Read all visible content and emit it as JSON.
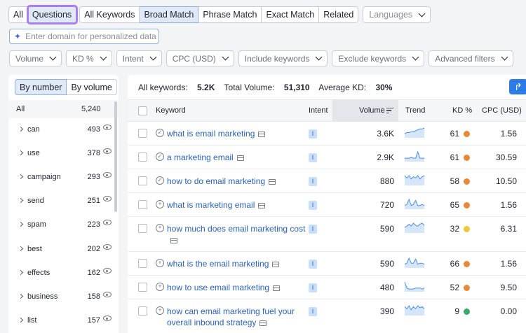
{
  "tabs": {
    "all": "All",
    "questions": "Questions",
    "all_keywords": "All Keywords",
    "broad_match": "Broad Match",
    "phrase_match": "Phrase Match",
    "exact_match": "Exact Match",
    "related": "Related",
    "languages": "Languages"
  },
  "domain_input": {
    "placeholder": "Enter domain for personalized data"
  },
  "filters": {
    "volume": "Volume",
    "kd": "KD %",
    "intent": "Intent",
    "cpc": "CPC (USD)",
    "include": "Include keywords",
    "exclude": "Exclude keywords",
    "advanced": "Advanced filters"
  },
  "left_panel": {
    "by_number": "By number",
    "by_volume": "By volume",
    "all_label": "All",
    "all_count": "5,240",
    "items": [
      {
        "name": "can",
        "count": "493"
      },
      {
        "name": "use",
        "count": "378"
      },
      {
        "name": "campaign",
        "count": "293"
      },
      {
        "name": "send",
        "count": "251"
      },
      {
        "name": "spam",
        "count": "223"
      },
      {
        "name": "best",
        "count": "202"
      },
      {
        "name": "effects",
        "count": "162"
      },
      {
        "name": "business",
        "count": "158"
      },
      {
        "name": "list",
        "count": "157"
      }
    ]
  },
  "summary": {
    "all_keywords_label": "All keywords:",
    "all_keywords_value": "5.2K",
    "total_volume_label": "Total Volume:",
    "total_volume_value": "51,310",
    "avg_kd_label": "Average KD:",
    "avg_kd_value": "30%"
  },
  "table": {
    "headers": {
      "keyword": "Keyword",
      "intent": "Intent",
      "volume": "Volume",
      "trend": "Trend",
      "kd": "KD %",
      "cpc": "CPC (USD)"
    },
    "rows": [
      {
        "keyword": "what is email marketing",
        "status": "check",
        "intent": "I",
        "volume": "3.6K",
        "kd": "61",
        "kd_color": "#e8893a",
        "cpc": "1.56",
        "trend": [
          4,
          5,
          5,
          6,
          6,
          7,
          8,
          9,
          9,
          10
        ]
      },
      {
        "keyword": "a marketing email",
        "status": "check",
        "intent": "I",
        "volume": "2.9K",
        "kd": "61",
        "kd_color": "#e8893a",
        "cpc": "30.59",
        "trend": [
          3,
          3,
          3,
          4,
          3,
          3,
          10,
          3,
          3,
          3
        ]
      },
      {
        "keyword": "how to do email marketing",
        "status": "check",
        "intent": "I",
        "volume": "880",
        "kd": "58",
        "kd_color": "#e8893a",
        "cpc": "10.50",
        "trend": [
          8,
          6,
          8,
          5,
          7,
          6,
          8,
          5,
          7,
          8
        ]
      },
      {
        "keyword": "what is marketing email",
        "status": "plus",
        "intent": "I",
        "volume": "720",
        "kd": "65",
        "kd_color": "#e8893a",
        "cpc": "1.56",
        "trend": [
          3,
          4,
          9,
          3,
          4,
          8,
          3,
          3,
          4,
          3
        ]
      },
      {
        "keyword": "how much does email marketing cost",
        "status": "plus",
        "intent": "I",
        "volume": "590",
        "kd": "32",
        "kd_color": "#f0c541",
        "cpc": "6.31",
        "trend": [
          5,
          6,
          8,
          6,
          9,
          7,
          6,
          8,
          9,
          7
        ]
      },
      {
        "keyword": "what is the email marketing",
        "status": "plus",
        "intent": "I",
        "volume": "590",
        "kd": "66",
        "kd_color": "#e8893a",
        "cpc": "1.56",
        "trend": [
          3,
          4,
          9,
          4,
          4,
          8,
          3,
          4,
          4,
          3
        ]
      },
      {
        "keyword": "how to use email marketing",
        "status": "plus",
        "intent": "I",
        "volume": "480",
        "kd": "52",
        "kd_color": "#e8893a",
        "cpc": "9.50",
        "trend": [
          9,
          3,
          2,
          2,
          2,
          3,
          3,
          3,
          2,
          3
        ]
      },
      {
        "keyword": "how can email marketing fuel your overall inbound strategy",
        "status": "plus",
        "intent": "I",
        "volume": "390",
        "kd": "9",
        "kd_color": "#3aaa6a",
        "cpc": "0.00",
        "trend": [
          8,
          6,
          9,
          5,
          8,
          6,
          9,
          7,
          8,
          6
        ]
      }
    ]
  }
}
